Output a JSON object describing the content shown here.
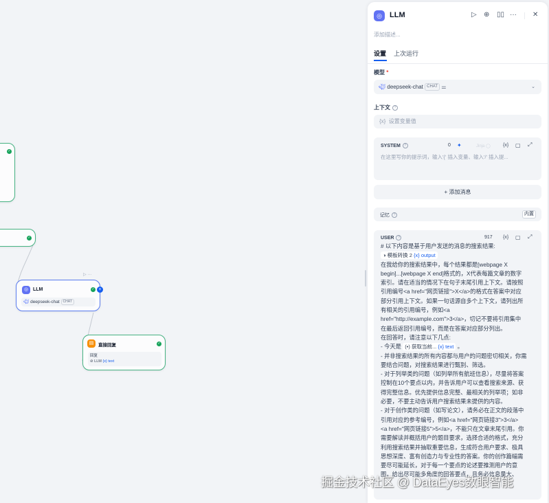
{
  "canvas": {
    "llm_node": {
      "title": "LLM",
      "model": "deepseek-chat",
      "model_badge": "CHAT"
    },
    "answer_node": {
      "title": "直接回复",
      "field_label": "回复",
      "source_node": "LLM",
      "var_icon": "{x}",
      "var_name": "text"
    }
  },
  "panel": {
    "title": "LLM",
    "description_placeholder": "添加描述...",
    "tabs": [
      {
        "label": "设置"
      },
      {
        "label": "上次运行"
      }
    ],
    "model": {
      "label": "模型",
      "required_mark": "*",
      "name": "deepseek-chat",
      "badge": "CHAT"
    },
    "context": {
      "label": "上下文",
      "var_icon": "{x}",
      "placeholder": "设置变量值"
    },
    "system": {
      "label": "SYSTEM",
      "count": "0",
      "jinja_label": "Jinja",
      "var_icon": "{x}",
      "placeholder": "在这里写你的提示词，输入'{' 插入变量、输入'/' 插入提..."
    },
    "add_message": "+ 添加消息",
    "memory": {
      "label": "记忆",
      "badge": "内置"
    },
    "user": {
      "label": "USER",
      "count": "917",
      "var_icon": "{x}",
      "line_first": "# 以下内容是基于用户发送的消息的搜索结果:",
      "chip1_node": "模板转换 2",
      "chip1_var": "{x} output",
      "lines_a": [
        "在我给你的搜索结果中，每个结果都是[webpage X",
        "begin]...[webpage X end]格式的，X代表每篇文章的数字",
        "索引。请在适当的情况下在句子末尾引用上下文。请按照",
        "引用编号<a href=\"网页链接\">X</a>的格式在答案中对应",
        "部分引用上下文。如果一句话源自多个上下文，请列出所",
        "有相关的引用编号，例如<a",
        "href=\"http://example.com\">3</a>，切记不要将引用集中",
        "在最后返回引用编号，而是在答案对应部分列出。",
        "在回答时，请注意以下几点:"
      ],
      "today_prefix": "- 今天是",
      "chip2_node": "(•) 获取当前...",
      "chip2_var": "{x} text",
      "today_suffix": "。",
      "lines_b": [
        "- 并非搜索结果的所有内容都与用户的问题密切相关，你需",
        "要结合问题，对搜索结果进行甄别、筛选。",
        "- 对于列举类的问题（如列举所有航班信息），尽量将答案",
        "控制在10个要点以内，并告诉用户可以查看搜索来源、获",
        "得完整信息。优先提供信息完整、最相关的列举项；如非",
        "必要，不要主动告诉用户搜索结果未提供的内容。",
        "- 对于创作类的问题（如写论文），请务必在正文的段落中",
        "引用对应的参考编号，例如<a href=\"网页链接3\">3</a>",
        "<a href=\"网页链接5\">5</a>，不能只在文章末尾引用。你",
        "需要解读并概括用户的题目要求，选择合适的格式，充分",
        "利用搜索结果并抽取重要信息，生成符合用户要求、极具",
        "思想深度、富有创造力与专业性的答案。你的创作篇幅需",
        "要尽可能延长，对于每一个要点的论述要推测用户的意",
        "图，给出尽可能多角度的回答要点，且务必信息量大、"
      ]
    }
  },
  "watermark": "掘金技术社区 @ DataEyes数眼智能",
  "colors": {
    "accent": "#155eef",
    "success": "#17a35b",
    "llm_icon": "#6172f3",
    "answer_icon": "#f79009"
  }
}
